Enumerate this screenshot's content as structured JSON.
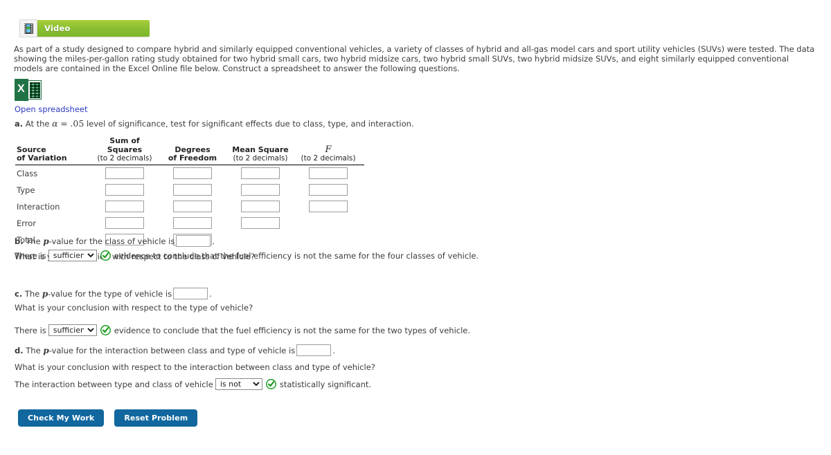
{
  "video_banner": {
    "label": "Video",
    "icon": "filmstrip-icon",
    "color": "#8cc033"
  },
  "intro": {
    "text": "As part of a study designed to compare hybrid and similarly equipped conventional vehicles, a variety of classes of hybrid and all-gas model cars and sport utility vehicles (SUVs) were tested. The data showing the miles-per-gallon rating study obtained for two hybrid small cars, two hybrid midsize cars, two hybrid small SUVs, two hybrid midsize SUVs, and eight similarly equipped conventional models are contained in the Excel Online file below. Construct a spreadsheet to answer the following questions."
  },
  "spreadsheet": {
    "icon": "excel-icon",
    "link_label": "Open spreadsheet",
    "link_color": "#2b39c4"
  },
  "question_a": {
    "label": "a.",
    "text_before": "At the",
    "alpha": "α",
    "equals": "=",
    "level": ".05",
    "text_after": "level of significance, test for significant effects due to class, type, and interaction."
  },
  "anova_table": {
    "headers": [
      {
        "main": "Source",
        "sub": "of Variation",
        "italic": false
      },
      {
        "main": "Sum of Squares",
        "sub": "(to 2 decimals)",
        "italic": false
      },
      {
        "main": "Degrees",
        "sub": "of Freedom",
        "italic": false
      },
      {
        "main": "Mean Square",
        "sub": "(to 2 decimals)",
        "italic": false
      },
      {
        "main": "F",
        "sub": "(to 2 decimals)",
        "italic": true
      }
    ],
    "rows": [
      {
        "label": "Class",
        "inputs": 4,
        "values": [
          "",
          "",
          "",
          ""
        ]
      },
      {
        "label": "Type",
        "inputs": 4,
        "values": [
          "",
          "",
          "",
          ""
        ]
      },
      {
        "label": "Interaction",
        "inputs": 4,
        "values": [
          "",
          "",
          "",
          ""
        ]
      },
      {
        "label": "Error",
        "inputs": 3,
        "values": [
          "",
          "",
          ""
        ]
      },
      {
        "label": "Total",
        "inputs": 2,
        "values": [
          "",
          ""
        ]
      }
    ]
  },
  "question_b": {
    "label": "b.",
    "stem_prefix": "The",
    "stem_p": "p",
    "stem_suffix": "-value for the class of vehicle is",
    "pvalue": "",
    "period": ".",
    "prompt": "What is your conclusion with respect to the class of vehicle?",
    "conclusion_prefix": "There is",
    "dropdown_value": "sufficient",
    "dropdown_options": [
      "sufficient",
      "insufficient"
    ],
    "status_icon": "green-check-icon",
    "conclusion_suffix": "evidence to conclude that the fuel efficiency is not the same for the four classes of vehicle."
  },
  "question_c": {
    "label": "c.",
    "stem_prefix": "The",
    "stem_p": "p",
    "stem_suffix": "-value for the type of vehicle is",
    "pvalue": "",
    "period": ".",
    "prompt": "What is your conclusion with respect to the type of vehicle?",
    "conclusion_prefix": "There is",
    "dropdown_value": "sufficient",
    "dropdown_options": [
      "sufficient",
      "insufficient"
    ],
    "status_icon": "green-check-icon",
    "conclusion_suffix": "evidence to conclude that the fuel efficiency is not the same for the two types of vehicle."
  },
  "question_d": {
    "label": "d.",
    "stem_prefix": "The",
    "stem_p": "p",
    "stem_suffix": "-value for the interaction between class and type of vehicle is",
    "pvalue": "",
    "period": ".",
    "prompt": "What is your conclusion with respect to the interaction between class and type of vehicle?",
    "conclusion_prefix": "The interaction between type and class of vehicle",
    "dropdown_value": "is not",
    "dropdown_options": [
      "is",
      "is not"
    ],
    "status_icon": "green-check-icon",
    "conclusion_suffix": "statistically significant."
  },
  "buttons": {
    "check": "Check My Work",
    "reset": "Reset Problem",
    "color": "#11679e"
  }
}
